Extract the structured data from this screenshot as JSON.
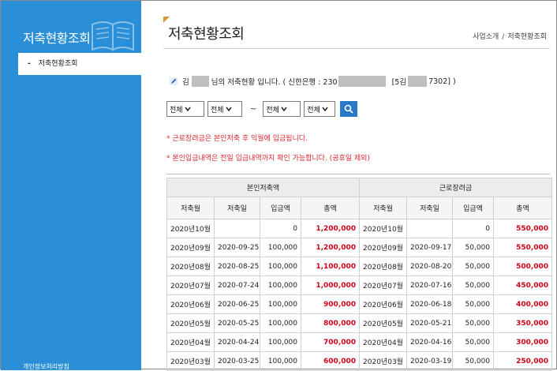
{
  "sidebar": {
    "title": "저축현황조회",
    "active_item": "저축현황조회",
    "active_marker": "-",
    "footer": "개인정보처리방침"
  },
  "header": {
    "title": "저축현황조회",
    "breadcrumb": [
      "사업소개",
      "저축현황조회"
    ],
    "separator": "/"
  },
  "info": {
    "prefix": "김",
    "middle": "님의 저축현황 입니다. ( 신한은행 : 230",
    "bracket_open": "[5김",
    "suffix": "7302] )"
  },
  "filters": {
    "start_year": "전체",
    "start_month": "전체",
    "tilde": "~",
    "end_year": "전체",
    "end_month": "전체"
  },
  "notes": [
    "* 근로장려금은 본인저축 후 익월에 입금됩니다.",
    "* 본인입금내역은 전일 입금내역까지 확인 가능합니다. (공휴일 제외)"
  ],
  "table": {
    "groups": [
      "본인저축액",
      "근로장려금"
    ],
    "columns": [
      "저축월",
      "저축일",
      "입금액",
      "총액",
      "저축월",
      "저축일",
      "입금액",
      "총액"
    ],
    "rows": [
      [
        "2020년10월",
        "",
        "0",
        "1,200,000",
        "2020년10월",
        "",
        "0",
        "550,000"
      ],
      [
        "2020년09월",
        "2020-09-25",
        "100,000",
        "1,200,000",
        "2020년09월",
        "2020-09-17",
        "50,000",
        "550,000"
      ],
      [
        "2020년08월",
        "2020-08-25",
        "100,000",
        "1,100,000",
        "2020년08월",
        "2020-08-20",
        "50,000",
        "500,000"
      ],
      [
        "2020년07월",
        "2020-07-24",
        "100,000",
        "1,000,000",
        "2020년07월",
        "2020-07-16",
        "50,000",
        "450,000"
      ],
      [
        "2020년06월",
        "2020-06-25",
        "100,000",
        "900,000",
        "2020년06월",
        "2020-06-18",
        "50,000",
        "400,000"
      ],
      [
        "2020년05월",
        "2020-05-25",
        "100,000",
        "800,000",
        "2020년05월",
        "2020-05-21",
        "50,000",
        "350,000"
      ],
      [
        "2020년04월",
        "2020-04-24",
        "100,000",
        "700,000",
        "2020년04월",
        "2020-04-16",
        "50,000",
        "300,000"
      ],
      [
        "2020년03월",
        "2020-03-25",
        "100,000",
        "600,000",
        "2020년03월",
        "2020-03-19",
        "50,000",
        "250,000"
      ]
    ]
  },
  "colors": {
    "sidebar_bg": "#2a8fd6",
    "accent_red": "#d0021b",
    "search_btn": "#2a78c8"
  }
}
